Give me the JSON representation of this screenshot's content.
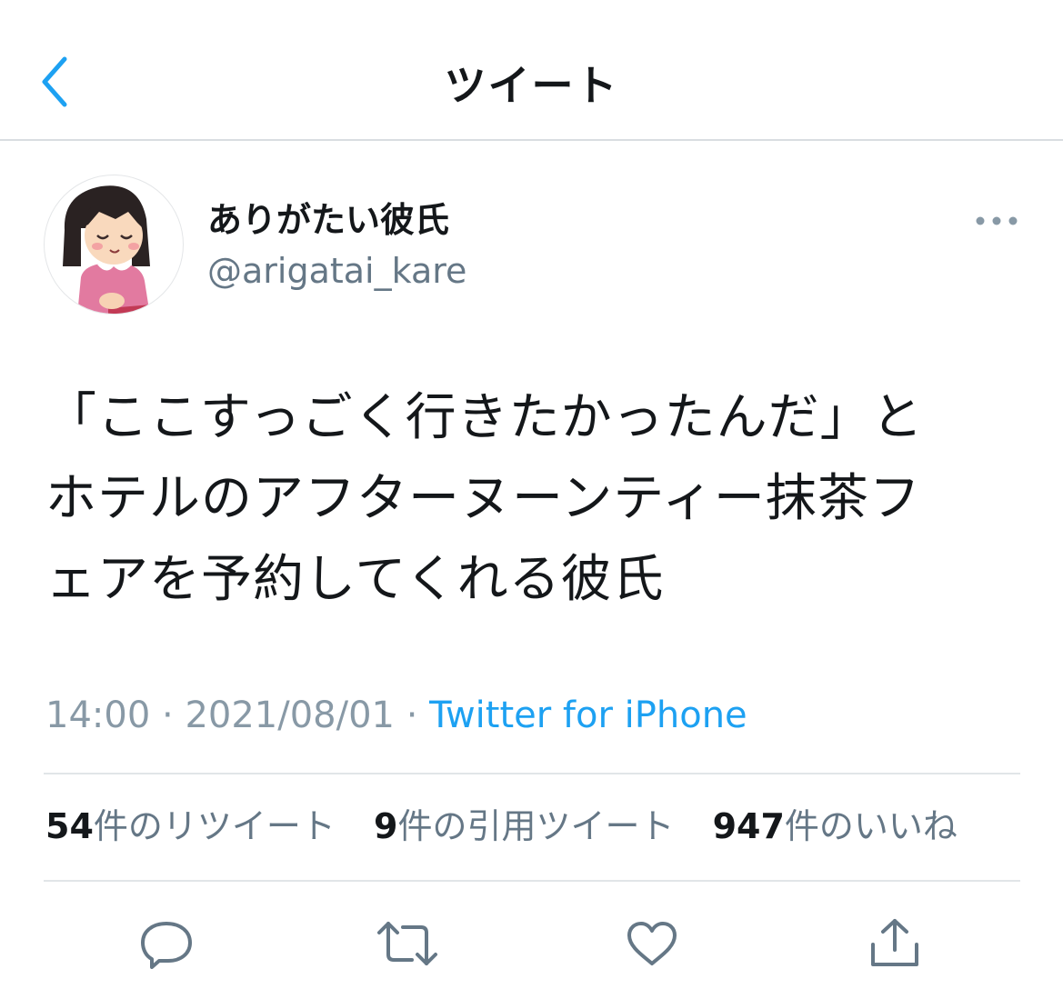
{
  "nav": {
    "title": "ツイート"
  },
  "user": {
    "name": "ありがたい彼氏",
    "handle": "@arigatai_kare"
  },
  "tweet": {
    "text": "「ここすっごく行きたかったんだ」と\nホテルのアフターヌーンティー抹茶フ\nェアを予約してくれる彼氏",
    "time": "14:00",
    "date": "2021/08/01",
    "separator": "·",
    "source": "Twitter for iPhone"
  },
  "stats": {
    "retweets": {
      "count": "54",
      "label": "件のリツイート"
    },
    "quotes": {
      "count": "9",
      "label": "件の引用ツイート"
    },
    "likes": {
      "count": "947",
      "label": "件のいいね"
    }
  },
  "icons": {
    "back": "chevron-left-icon",
    "more": "more-dots-icon",
    "reply": "reply-icon",
    "retweet": "retweet-icon",
    "like": "heart-icon",
    "share": "share-icon"
  },
  "colors": {
    "accent": "#1da1f2",
    "secondary_text": "#657786",
    "divider": "#e1e5e8"
  }
}
